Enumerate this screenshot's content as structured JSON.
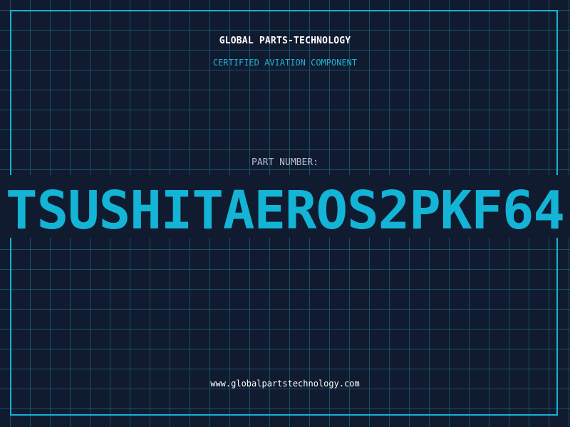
{
  "header": {
    "company": "GLOBAL PARTS-TECHNOLOGY",
    "subtitle": "CERTIFIED AVIATION COMPONENT"
  },
  "part": {
    "label": "PART NUMBER:",
    "number": "TSUSHITAEROS2PKF64"
  },
  "footer": {
    "website": "www.globalpartstechnology.com"
  },
  "colors": {
    "background": "#101b2f",
    "accent": "#13b4d6",
    "grid": "#22789a",
    "text": "#ffffff",
    "label": "#b3bfcf"
  }
}
